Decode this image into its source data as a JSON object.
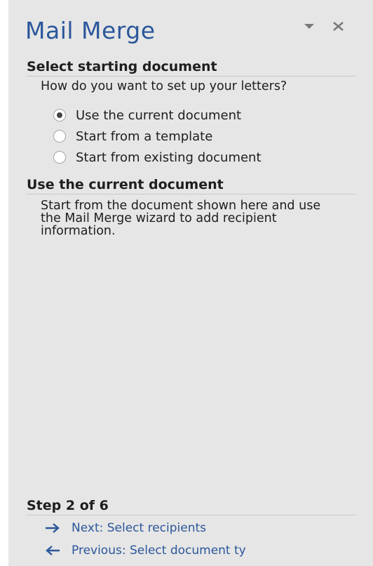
{
  "pane": {
    "title": "Mail Merge",
    "menu_icon": "dropdown-triangle-icon",
    "close_icon": "close-x-icon"
  },
  "select_doc": {
    "heading": "Select starting document",
    "prompt": "How do you want to set up your letters?",
    "options": [
      {
        "label": "Use the current document",
        "selected": true
      },
      {
        "label": "Start from a template",
        "selected": false
      },
      {
        "label": "Start from existing document",
        "selected": false
      }
    ]
  },
  "current_doc": {
    "heading": "Use the current document",
    "description": "Start from the document shown here and use the Mail Merge wizard to add recipient information."
  },
  "step": {
    "heading": "Step 2 of 6",
    "next_label": "Next: Select recipients",
    "next_icon": "arrow-right-icon",
    "previous_label": "Previous: Select document ty",
    "previous_icon": "arrow-left-icon"
  },
  "colors": {
    "title_blue": "#2b579a",
    "pane_background": "#e6e6e6",
    "text": "#1e1e1e"
  }
}
